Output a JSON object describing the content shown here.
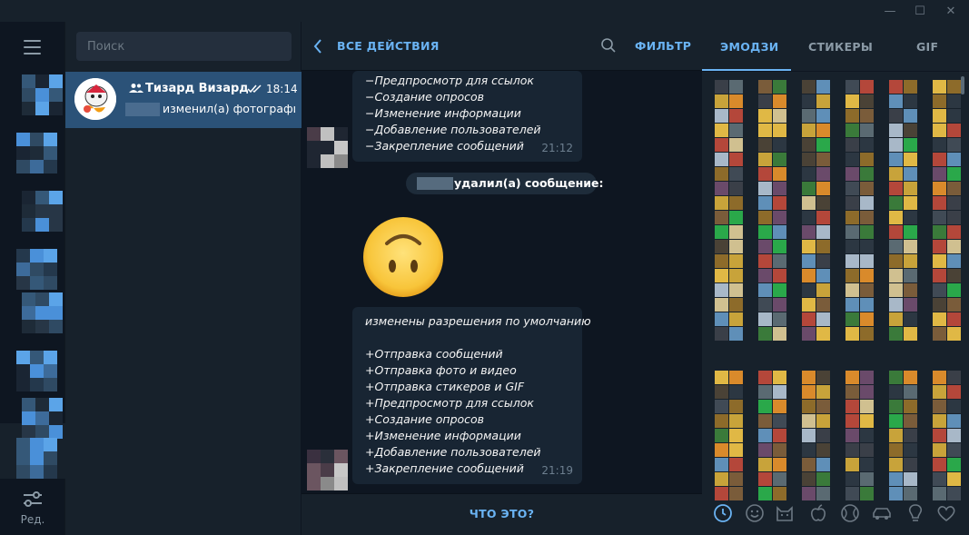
{
  "search": {
    "placeholder": "Поиск"
  },
  "rail": {
    "edit_label": "Ред."
  },
  "chat": {
    "name": "Тизард Визард",
    "time": "18:14",
    "preview": "изменил(а) фотографию"
  },
  "header": {
    "title": "ВСЕ ДЕЙСТВИЯ",
    "filter": "ФИЛЬТР"
  },
  "messages": {
    "first": {
      "lines": [
        "−Предпросмотр для ссылок",
        "−Создание опросов",
        "−Изменение информации",
        "−Добавление пользователей",
        "−Закрепление сообщений"
      ],
      "time": "21:12"
    },
    "service": "удалил(а) сообщение:",
    "second": {
      "lines": [
        "изменены разрешения по умолчанию",
        "",
        "+Отправка сообщений",
        "+Отправка фото и видео",
        "+Отправка стикеров и GIF",
        "+Предпросмотр для ссылок",
        "+Создание опросов",
        "+Изменение информации",
        "+Добавление пользователей",
        "+Закрепление сообщений"
      ],
      "time": "21:19"
    }
  },
  "footer": {
    "what_label": "ЧТО ЭТО?"
  },
  "panel": {
    "tabs": [
      {
        "label": "ЭМОДЗИ",
        "active": true
      },
      {
        "label": "СТИКЕРЫ",
        "active": false
      },
      {
        "label": "GIF",
        "active": false
      }
    ],
    "categories": [
      "recent-icon",
      "smile-icon",
      "cat-icon",
      "apple-icon",
      "ball-icon",
      "car-icon",
      "lightbulb-icon",
      "heart-icon"
    ]
  },
  "colors": {
    "accent": "#6ab3f3",
    "selected": "#2b5278",
    "background": "#0e1621",
    "panel": "#17212b"
  }
}
